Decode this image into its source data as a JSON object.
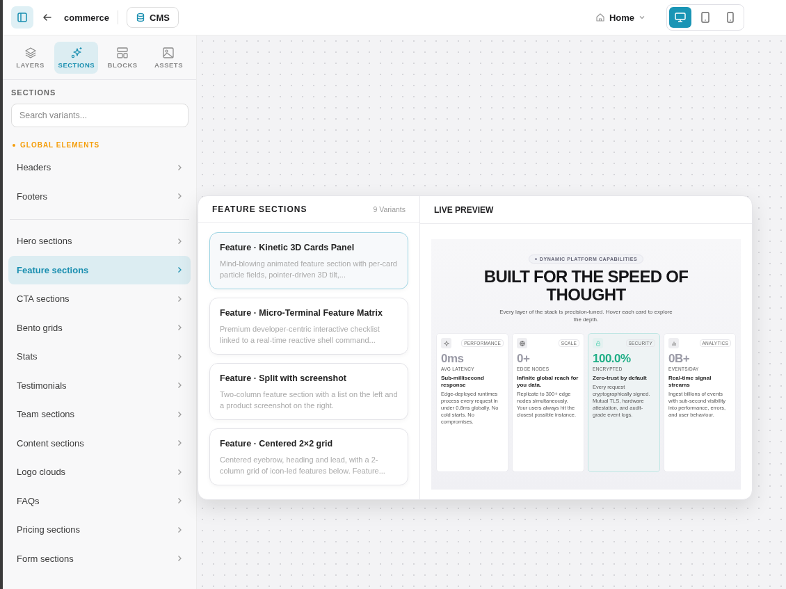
{
  "topbar": {
    "project": "commerce",
    "cms": "CMS",
    "page": "Home",
    "devices": [
      {
        "kind": "desktop",
        "selected": true
      },
      {
        "kind": "tablet",
        "selected": false
      },
      {
        "kind": "phone",
        "selected": false
      }
    ]
  },
  "tabs": [
    {
      "kind": "layers",
      "label": "LAYERS",
      "selected": false
    },
    {
      "kind": "sections",
      "label": "SECTIONS",
      "selected": true
    },
    {
      "kind": "blocks",
      "label": "BLOCKS",
      "selected": false
    },
    {
      "kind": "assets",
      "label": "ASSETS",
      "selected": false
    }
  ],
  "sidebar": {
    "heading": "SECTIONS",
    "search": {
      "placeholder": "Search variants..."
    },
    "groups": [
      {
        "label": "GLOBAL ELEMENTS",
        "items": [
          {
            "label": "Headers",
            "selected": false
          },
          {
            "label": "Footers",
            "selected": false
          }
        ]
      },
      {
        "items": [
          {
            "label": "Hero sections",
            "selected": false
          },
          {
            "label": "Feature sections",
            "selected": true
          },
          {
            "label": "CTA sections",
            "selected": false
          },
          {
            "label": "Bento grids",
            "selected": false
          },
          {
            "label": "Stats",
            "selected": false
          },
          {
            "label": "Testimonials",
            "selected": false
          },
          {
            "label": "Team sections",
            "selected": false
          },
          {
            "label": "Content sections",
            "selected": false
          },
          {
            "label": "Logo clouds",
            "selected": false
          },
          {
            "label": "FAQs",
            "selected": false
          },
          {
            "label": "Pricing sections",
            "selected": false
          },
          {
            "label": "Form sections",
            "selected": false
          }
        ]
      }
    ]
  },
  "popup": {
    "title": "FEATURE SECTIONS",
    "count": "9 Variants",
    "variants": [
      {
        "title": "Feature · Kinetic 3D Cards Panel",
        "description": "Mind-blowing animated feature section with per-card particle fields, pointer-driven 3D tilt,...",
        "selected": true
      },
      {
        "title": "Feature · Micro-Terminal Feature Matrix",
        "description": "Premium developer-centric interactive checklist linked to a real-time reactive shell command...",
        "selected": false
      },
      {
        "title": "Feature · Split with screenshot",
        "description": "Two-column feature section with a list on the left and a product screenshot on the right.",
        "selected": false
      },
      {
        "title": "Feature · Centered 2×2 grid",
        "description": "Centered eyebrow, heading and lead, with a 2-column grid of icon-led features below. Feature...",
        "selected": false
      }
    ],
    "preview_title": "LIVE PREVIEW",
    "preview": {
      "eyebrow": "DYNAMIC PLATFORM CAPABILITIES",
      "heading": "BUILT FOR THE SPEED OF THOUGHT",
      "lead": "Every layer of the stack is precision-tuned. Hover each card to explore the depth.",
      "cards": [
        {
          "kind": "sparkle",
          "tag": "PERFORMANCE",
          "value": "0ms",
          "unit": "AVG LATENCY",
          "title": "Sub-millisecond response",
          "text": "Edge-deployed runtimes process every request in under 0.8ms globally. No cold starts. No compromises.",
          "selected": false
        },
        {
          "kind": "globe",
          "tag": "SCALE",
          "value": "0+",
          "unit": "EDGE NODES",
          "title": "Infinite global reach for you data.",
          "text": "Replicate to 300+ edge nodes simultaneously. Your users always hit the closest possible instance.",
          "selected": false
        },
        {
          "kind": "lock",
          "tag": "SECURITY",
          "value": "100.0%",
          "unit": "ENCRYPTED",
          "title": "Zero-trust by default",
          "text": "Every request cryptographically signed. Mutual TLS, hardware attestation, and audit-grade event logs.",
          "selected": true
        },
        {
          "kind": "chart",
          "tag": "ANALYTICS",
          "value": "0B+",
          "unit": "EVENTS/DAY",
          "title": "Real-time signal streams",
          "text": "Ingest billions of events with sub-second visibility into performance, errors, and user behaviour.",
          "selected": false
        }
      ]
    }
  }
}
